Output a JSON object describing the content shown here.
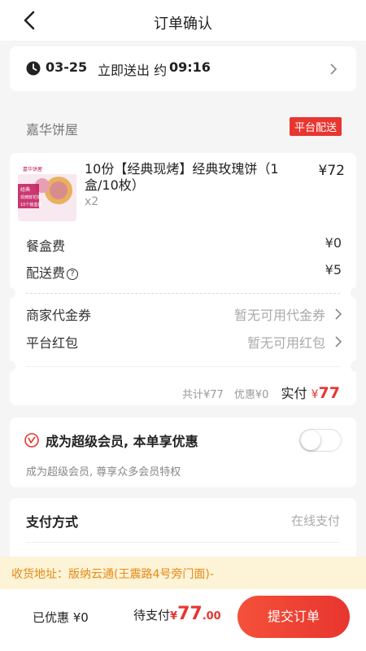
{
  "header": {
    "title": "订单确认"
  },
  "delivery": {
    "date": "03-25",
    "mode": "立即送出 约",
    "time": "09:16"
  },
  "shop": {
    "name": "嘉华饼屋",
    "badge": "平台配送"
  },
  "item": {
    "name": "10份【经典现烤】经典玫瑰饼（1盒/10枚）",
    "price": "¥72",
    "qty": "x2",
    "image_texts": {
      "brand": "嘉华饼屋",
      "line1": "经典",
      "line2": "现烤鲜花饼",
      "line3": "10个装盒装"
    }
  },
  "fees": [
    {
      "label": "餐盒费",
      "value": "¥0"
    },
    {
      "label": "配送费",
      "value": "¥5"
    }
  ],
  "coupons": [
    {
      "label": "商家代金券",
      "value": "暂无可用代金券"
    },
    {
      "label": "平台红包",
      "value": "暂无可用红包"
    }
  ],
  "summary": {
    "total": "共计¥77",
    "discount": "优惠¥0",
    "pay_label": "实付",
    "currency": "¥",
    "amount": "77"
  },
  "vip": {
    "title": "成为超级会员, 本单享优惠",
    "subtitle": "成为超级会员, 尊享众多会员特权",
    "enabled": false
  },
  "payment": {
    "label": "支付方式",
    "value": "在线支付"
  },
  "address": {
    "text": "收货地址：版纳云通(王震路4号旁门面)-"
  },
  "bottom": {
    "discount": "已优惠 ¥0",
    "to_pay_label": "待支付",
    "currency": "¥",
    "amount": "77",
    "cents": ".00",
    "submit": "提交订单"
  },
  "colors": {
    "accent": "#e8352f",
    "address_bg": "#fdf3d6",
    "address_text": "#e58a17"
  }
}
